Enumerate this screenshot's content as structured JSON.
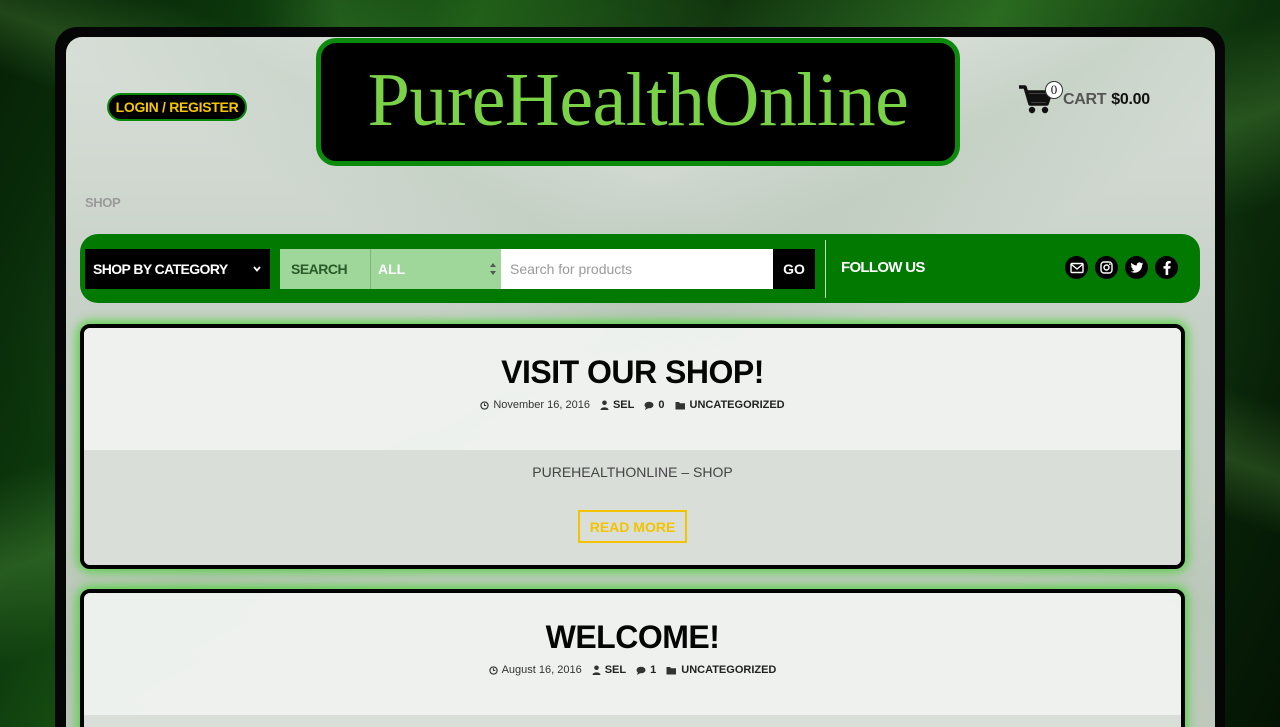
{
  "header": {
    "login_label": "LOGIN / REGISTER",
    "logo_text": "PureHealthOnline",
    "cart_count": "0",
    "cart_label": "CART",
    "cart_total": "$0.00"
  },
  "breadcrumb": "SHOP",
  "navbar": {
    "category_label": "SHOP BY CATEGORY",
    "search_label": "SEARCH",
    "scope_value": "ALL",
    "search_placeholder": "Search for products",
    "search_value": "",
    "go_label": "GO",
    "follow_label": "FOLLOW US",
    "social_icons": [
      "envelope-icon",
      "instagram-icon",
      "twitter-icon",
      "facebook-icon"
    ]
  },
  "posts": [
    {
      "title": "VISIT OUR SHOP!",
      "date": "November 16, 2016",
      "author": "SEL",
      "comments": "0",
      "category": "UNCATEGORIZED",
      "excerpt": "PUREHEALTHONLINE – SHOP",
      "read_more": "READ MORE"
    },
    {
      "title": "WELCOME!",
      "date": "August 16, 2016",
      "author": "SEL",
      "comments": "1",
      "category": "UNCATEGORIZED"
    }
  ],
  "colors": {
    "brand_green": "#027a02",
    "logo_text_green": "#7ad246",
    "accent_yellow": "#f3c300",
    "search_tint": "#9fd79a"
  }
}
